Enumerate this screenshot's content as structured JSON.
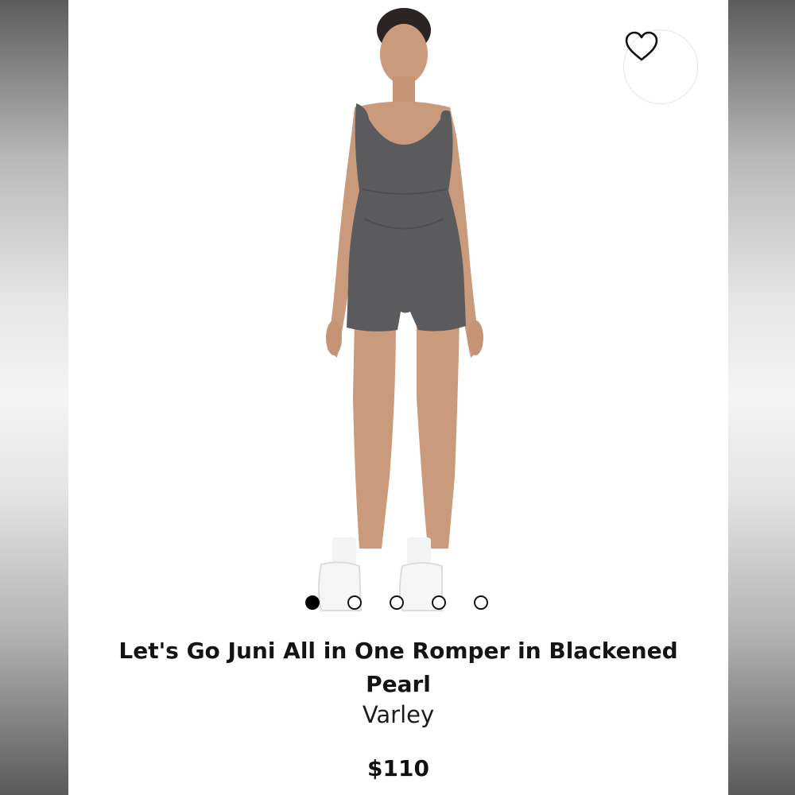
{
  "product": {
    "title": "Let's Go Juni All in One Romper in Blackened Pearl",
    "brand": "Varley",
    "price": "$110"
  },
  "gallery": {
    "image_count": 5,
    "active_index": 0,
    "favorite_icon": "heart-outline-icon"
  },
  "colors": {
    "romper": "#5b5b5e",
    "background": "#ffffff",
    "frame_gray": "#9a9a9a"
  }
}
